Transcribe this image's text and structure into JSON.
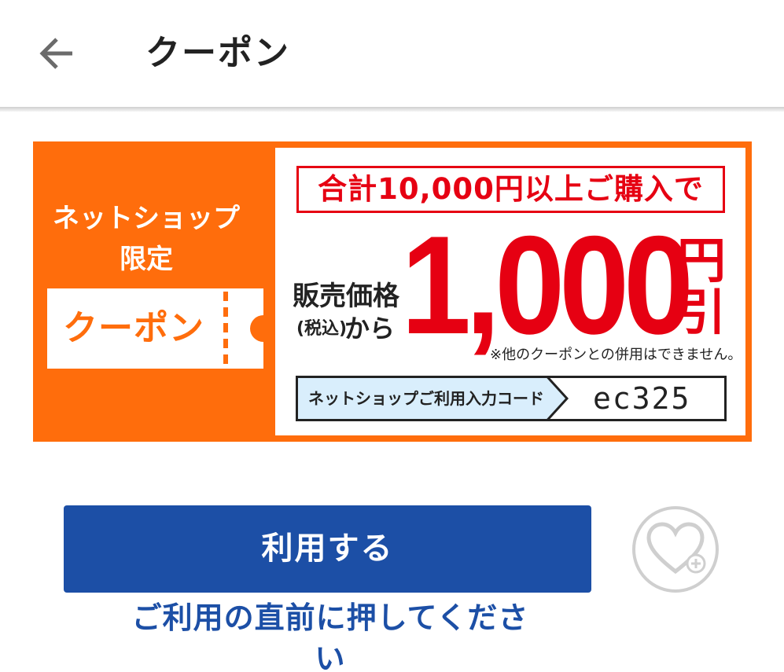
{
  "header": {
    "title": "クーポン",
    "back_icon": "arrow-left-icon"
  },
  "coupon": {
    "badge_line1": "ネットショップ",
    "badge_line2": "限定",
    "ticket_label": "クーポン",
    "condition": "合計10,000円以上ご購入で",
    "price_label": "販売価格",
    "tax_label": "(税込)",
    "from_label": "から",
    "amount": "1,000",
    "yen": "円",
    "discount": "引",
    "note": "※他のクーポンとの併用はできません。",
    "code_label": "ネットショップご利用入力コード",
    "code_value": "ec325",
    "colors": {
      "orange": "#ff6d0c",
      "red": "#e60012"
    }
  },
  "actions": {
    "use_label": "利用する",
    "hint": "ご利用の直前に押してください",
    "favorite_icon": "heart-plus-icon",
    "button_color": "#1c4fa6"
  }
}
